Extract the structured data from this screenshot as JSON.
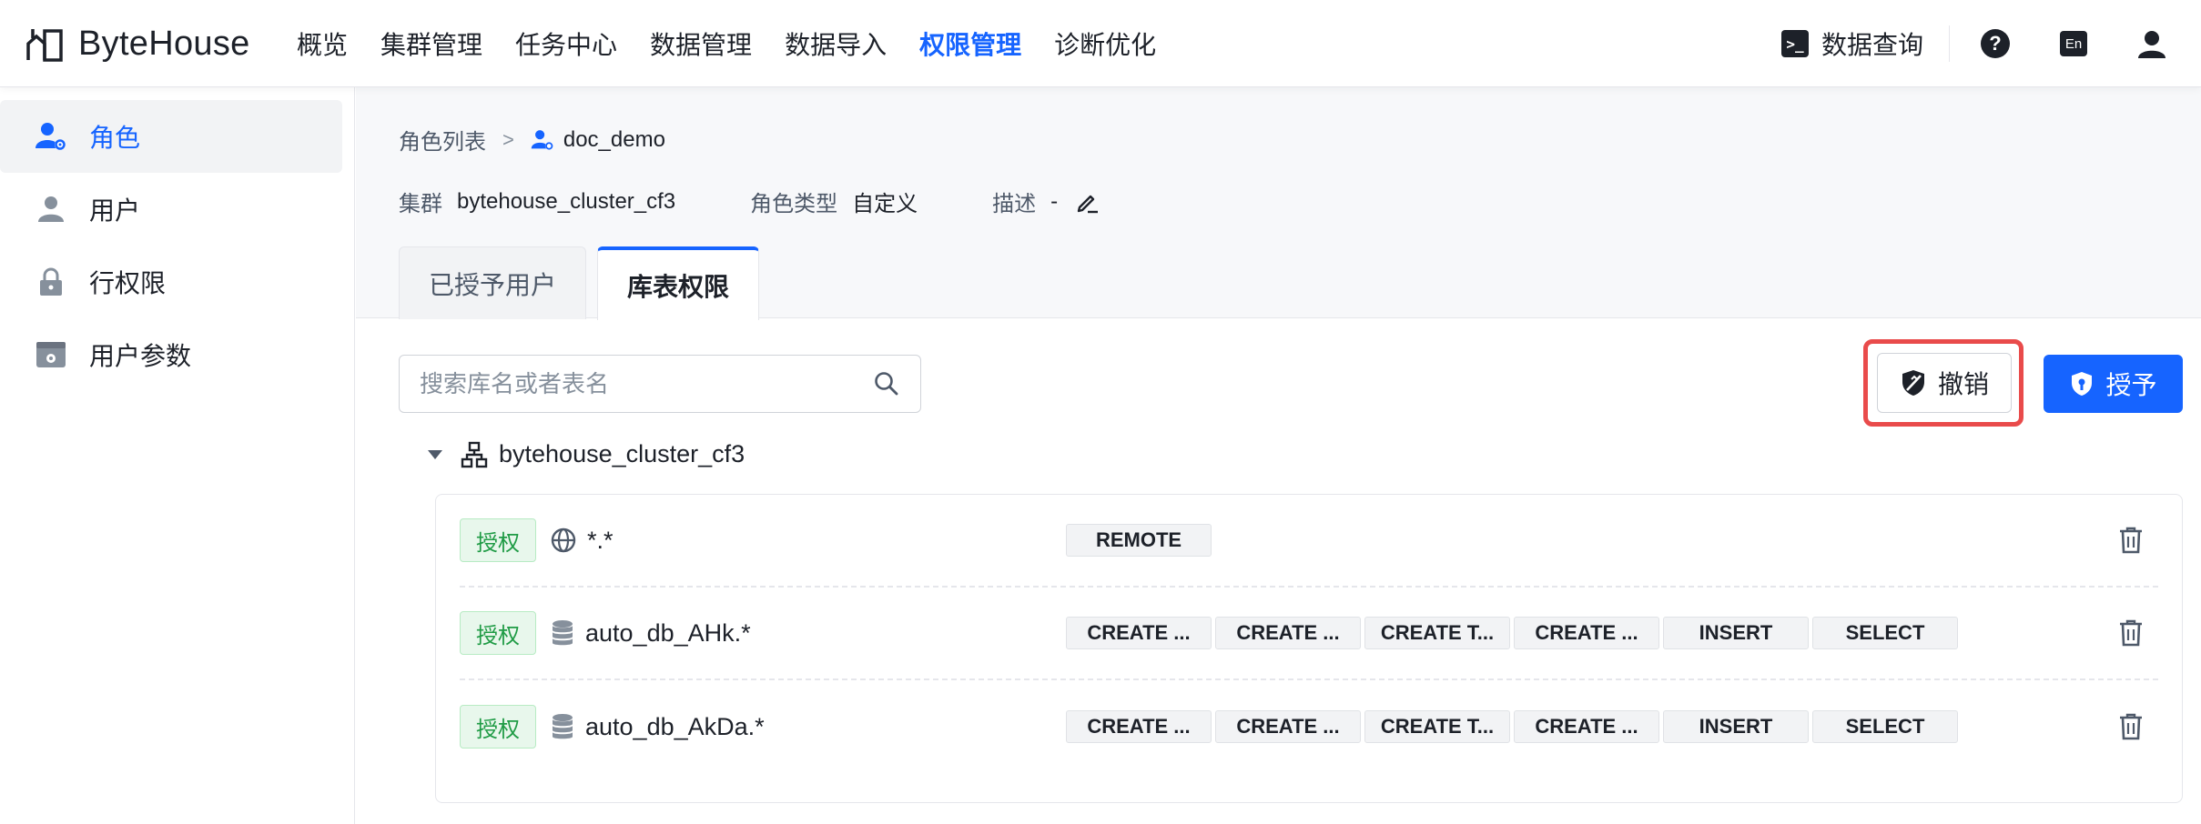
{
  "app": {
    "logo_text": "ByteHouse"
  },
  "nav": {
    "items": [
      "概览",
      "集群管理",
      "任务中心",
      "数据管理",
      "数据导入",
      "权限管理",
      "诊断优化"
    ],
    "active_index": 5,
    "query_icon_text": ">_",
    "query_label": "数据查询",
    "help_text": "?",
    "lang_label": "En"
  },
  "sidebar": {
    "items": [
      {
        "label": "角色",
        "icon": "role-icon",
        "active": true
      },
      {
        "label": "用户",
        "icon": "user-icon",
        "active": false
      },
      {
        "label": "行权限",
        "icon": "lock-icon",
        "active": false
      },
      {
        "label": "用户参数",
        "icon": "settings-window-icon",
        "active": false
      }
    ]
  },
  "breadcrumb": {
    "parent": "角色列表",
    "separator": ">",
    "current": "doc_demo"
  },
  "meta": {
    "cluster_label": "集群",
    "cluster_value": "bytehouse_cluster_cf3",
    "role_type_label": "角色类型",
    "role_type_value": "自定义",
    "desc_label": "描述",
    "desc_value": "-"
  },
  "tabs": [
    {
      "label": "已授予用户",
      "active": false
    },
    {
      "label": "库表权限",
      "active": true
    }
  ],
  "toolbar": {
    "search_placeholder": "搜索库名或者表名",
    "revoke_label": "撤销",
    "grant_label": "授予"
  },
  "tree": {
    "cluster_name": "bytehouse_cluster_cf3",
    "rows": [
      {
        "tag": "授权",
        "object_icon": "globe-icon",
        "object": "*.*",
        "privileges": [
          "REMOTE"
        ]
      },
      {
        "tag": "授权",
        "object_icon": "database-icon",
        "object": "auto_db_AHk.*",
        "privileges": [
          "CREATE ...",
          "CREATE ...",
          "CREATE T...",
          "CREATE ...",
          "INSERT",
          "SELECT"
        ]
      },
      {
        "tag": "授权",
        "object_icon": "database-icon",
        "object": "auto_db_AkDa.*",
        "privileges": [
          "CREATE ...",
          "CREATE ...",
          "CREATE T...",
          "CREATE ...",
          "INSERT",
          "SELECT"
        ]
      }
    ]
  },
  "colors": {
    "accent": "#1664ff",
    "grant_tag_text": "#1f9b45",
    "grant_tag_bg": "#e8f7ec",
    "highlight_outline": "#e94b4b"
  }
}
